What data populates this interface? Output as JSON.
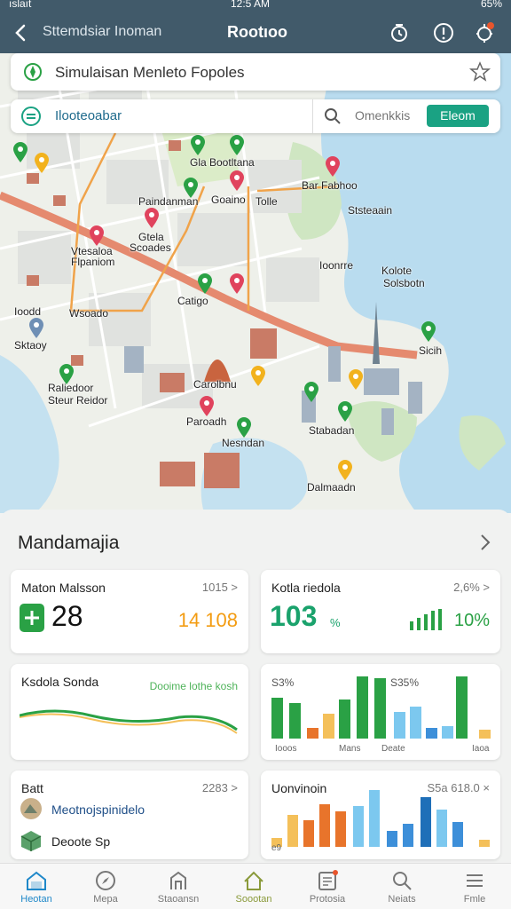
{
  "statusbar": {
    "carrier": "ıslaıt",
    "time": "12:5 AM",
    "battery": "65%"
  },
  "navbar": {
    "subtitle": "Sttemdsiar Inoman",
    "title": "Rootıoo"
  },
  "map": {
    "info_card_title": "Simulaisan Menleto Fopoles",
    "layer_label": "Ilooteoabar",
    "search_placeholder": "Omenkkis",
    "search_button": "Eleom",
    "labels": {
      "l1": "Gla Bootltana",
      "l2": "Paindanman",
      "l3": "Goaino",
      "l4": "Tolle",
      "l5": "Bar Fabhoo",
      "l6": "Ststeaain",
      "l7": "Gtela",
      "l8": "Scoades",
      "l9": "Flpaniom",
      "l10": "Vtesaloa",
      "l11": "Ioonrre",
      "l12": "Catigo",
      "l13": "Kolote",
      "l14": "Solsbotn",
      "l15": "Ioodd",
      "l16": "Wsoado",
      "l17": "Sktaoy",
      "l18": "Sicih",
      "l19": "Raliedoor",
      "l20": "Steur Reidor",
      "l21": "Carolbnu",
      "l22": "Paroadh",
      "l23": "Nesndan",
      "l24": "Stabadan",
      "l25": "Dalmaadn"
    }
  },
  "sheet": {
    "heading": "Mandamajia",
    "tiles": [
      {
        "title": "Maton Malsson",
        "meta": "1015 >",
        "big": "28",
        "side": "14 108"
      },
      {
        "title": "Kotla riedola",
        "meta": "2,6% >",
        "big": "103",
        "unit": "%",
        "side": "10%"
      },
      {
        "title": "Ksdola Sonda",
        "meta": "Dooime lothe kosh"
      },
      {
        "title": "",
        "meta": "",
        "tags": [
          "S3%",
          "S35%"
        ],
        "axis": [
          "Iooos",
          "Mans",
          "Deate",
          "Iaoa"
        ]
      },
      {
        "title": "Batt",
        "meta": "2283 >",
        "rows": [
          "Meotnojspinidelo",
          "Deoote Sp"
        ]
      },
      {
        "title": "Uonvinoin",
        "meta": "S5a 618.0 ×",
        "axis_left": "e9"
      }
    ]
  },
  "tabs": [
    {
      "label": "Heotan"
    },
    {
      "label": "Mepa"
    },
    {
      "label": "Staoansn"
    },
    {
      "label": "Soootan"
    },
    {
      "label": "Protosia"
    },
    {
      "label": "Neiats"
    },
    {
      "label": "Fmle"
    }
  ],
  "colors": {
    "nav": "#415a6a",
    "accent": "#1aa283",
    "tab_active": "#1f88c9",
    "green": "#24a23b",
    "orange": "#f39c12",
    "blue": "#1f88c9"
  }
}
